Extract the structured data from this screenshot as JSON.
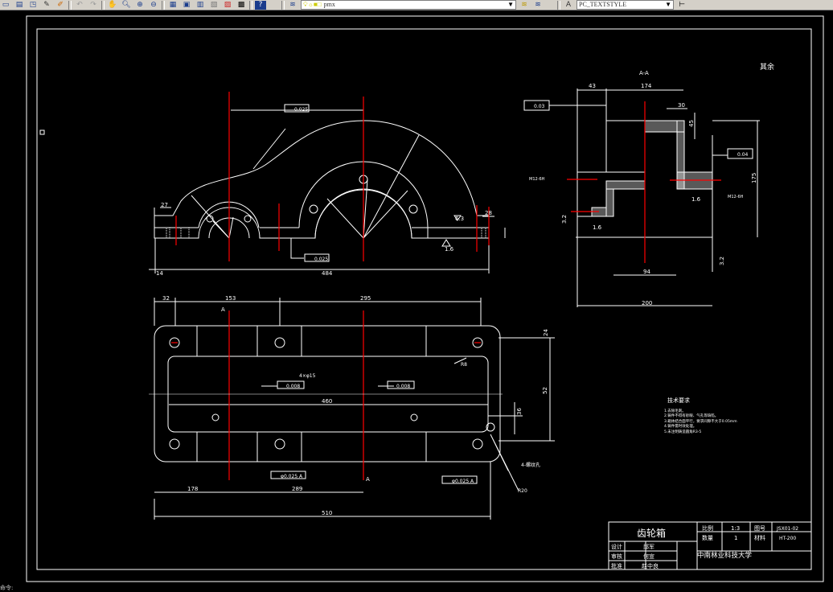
{
  "toolbar": {
    "layer_value": "pmx",
    "textstyle_value": "PC_TEXTSTYLE",
    "help_icon": "?",
    "icons": [
      "new-icon",
      "open-icon",
      "save-icon",
      "pencil-icon",
      "brush-icon",
      "undo-icon",
      "redo-icon",
      "pan-icon",
      "zoom-realtime-icon",
      "zoom-window-icon",
      "zoom-previous-icon",
      "properties-icon",
      "design-center-icon",
      "tool-palettes-icon",
      "sheet-set-icon",
      "markup-icon",
      "calculator-icon",
      "help-icon",
      "layer-manager-icon",
      "layer-state-icon"
    ]
  },
  "drawing": {
    "section_label": "A-A",
    "remaining_roughness": "其余",
    "section_marker": "A",
    "front_view": {
      "dims": [
        "27",
        "14",
        "484",
        "R",
        "R",
        "R",
        "R",
        "R",
        "R",
        "R",
        "28",
        "6.3",
        "1.6"
      ],
      "tolerance_parallel": "0.025",
      "tolerance_flatness": "0.025"
    },
    "top_view": {
      "dims": [
        "32",
        "153",
        "295",
        "460",
        "510",
        "178",
        "289",
        "52",
        "24",
        "36"
      ],
      "note_holes": "4×φ15",
      "note_threads": "4-螺纹孔",
      "flatness_1": "0.008",
      "flatness_2": "0.008",
      "position_1": "φ0.025 A",
      "position_2": "φ0.025 A",
      "radius_1": "R8",
      "radius_2": "R20"
    },
    "section_view": {
      "dims": [
        "43",
        "174",
        "30",
        "45",
        "175",
        "94",
        "200"
      ],
      "perp_1": "0.03",
      "perp_2": "0.04",
      "roughness": [
        "1.6",
        "1.6",
        "3.2",
        "3.2"
      ],
      "thread_left": "M12-6H",
      "thread_right": "M12-6H"
    },
    "tech_requirements": {
      "title": "技术要求",
      "items": [
        "1.去除毛刺。",
        "2.铸件不得有砂眼、气孔等缺陷。",
        "3.箱体结合面平行，要求间隙不大于0.05mm",
        "4.铸件需时效处理。",
        "5.未注明铸造圆角R3-5"
      ]
    },
    "title_block": {
      "part_name": "齿轮箱",
      "scale_label": "比例",
      "scale_value": "1:3",
      "qty_label": "数量",
      "qty_value": "1",
      "drawing_no_label": "图号",
      "drawing_no_value": "JSX01-02",
      "material_label": "材料",
      "material_value": "HT-200",
      "design_label": "设计",
      "design_value": "邱军",
      "check_label": "审核",
      "check_value": "何宣",
      "approve_label": "批准",
      "approve_value": "赵中良",
      "school": "中南林业科技大学"
    }
  },
  "status": {
    "command_line": "命令:"
  },
  "colors": {
    "background": "#000000",
    "lines": "#ffffff",
    "centerlines": "#ff0000",
    "toolbar": "#d4d0c8"
  }
}
